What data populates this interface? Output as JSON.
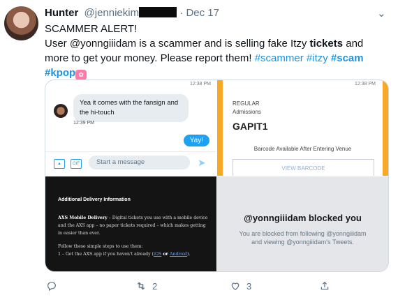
{
  "tweet": {
    "name": "Hunter",
    "handle": "@jenniekim",
    "separator": "·",
    "date": "Dec 17",
    "line1": "SCAMMER ALERT!",
    "line2_a": "User @yonngiiidam is a scammer and is selling fake Itzy ",
    "line2_b": "tickets",
    "line2_c": " and more to get your money. Please report them! ",
    "tag1": "#scammer",
    "tag2": "#itzy",
    "tag3": "#scam",
    "tag4": "#kpop"
  },
  "dm": {
    "time_top": "12:38 PM",
    "message": "Yea it comes with the fansign and the hi-touch",
    "message_time": "12:39 PM",
    "reply": "Yay!",
    "input_placeholder": "Start a message",
    "gif_label": "GIF"
  },
  "ticket": {
    "time_top": "12:38 PM",
    "type": "REGULAR",
    "admission": "Admissions",
    "event": "GAPIT1",
    "barcode_note": "Barcode Available After Entering Venue",
    "button": "VIEW BARCODE"
  },
  "email": {
    "heading": "Additional Delivery Information",
    "p1_bold": "AXS Mobile Delivery",
    "p1": " – Digital tickets you use with a mobile device and the AXS app – no paper tickets required – which makes getting in easier than ever.",
    "p2": "Follow these simple steps to use them:",
    "p3a": "1 – Get the AXS app if you haven't already (",
    "ios": "iOS",
    "or": " or ",
    "android": "Android",
    "p3b": ")."
  },
  "blocked": {
    "title": "@yonngiiidam blocked you",
    "text": "You are blocked from following @yonngiiidam and viewing @yonngiiidam's Tweets."
  },
  "actions": {
    "reply_count": "",
    "retweet_count": "2",
    "like_count": "3"
  },
  "colors": {
    "link": "#1b95e0",
    "accent": "#1da1f2",
    "ticket_orange": "#f7a826"
  }
}
